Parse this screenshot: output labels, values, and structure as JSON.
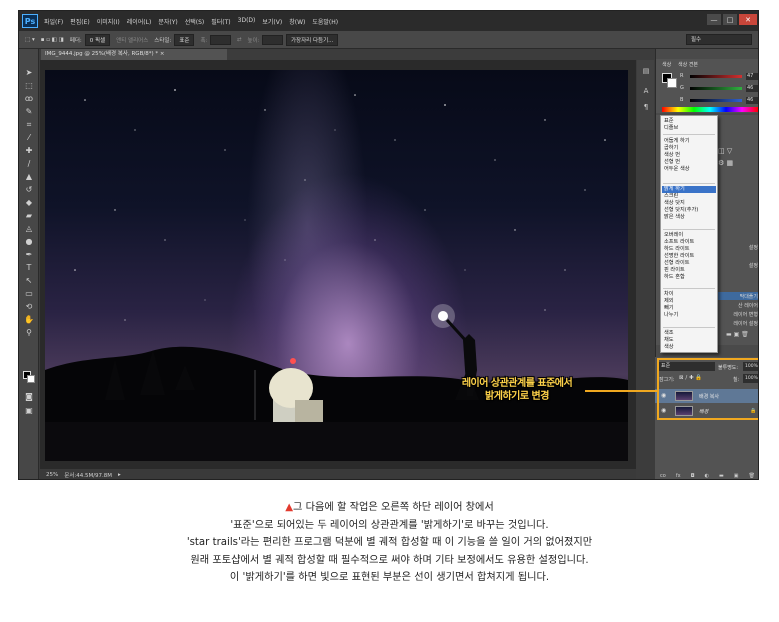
{
  "app": {
    "logo": "Ps",
    "menus": [
      "파일(F)",
      "편집(E)",
      "이미지(I)",
      "레이어(L)",
      "문자(Y)",
      "선택(S)",
      "필터(T)",
      "3D(D)",
      "보기(V)",
      "창(W)",
      "도움말(H)"
    ],
    "window_controls": [
      "—",
      "□",
      "✕"
    ]
  },
  "options_bar": {
    "feather_label": "페더:",
    "feather_value": "0 픽셀",
    "antialias": "앤티 앨리어스",
    "style_label": "스타일:",
    "style_value": "표준",
    "width_label": "폭:",
    "height_label": "높이:",
    "refine_edge": "가장자리 다듬기...",
    "workspace": "필수"
  },
  "document": {
    "tab": "IMG_9444.jpg @ 25%(배경 복사, RGB/8*) * ×"
  },
  "status_bar": {
    "zoom": "25%",
    "doc_info": "문서:44.5M/97.8M"
  },
  "color_panel": {
    "tabs": [
      "색상",
      "색상 견본"
    ],
    "channels": [
      {
        "label": "R",
        "value": "47",
        "color": "#d23030"
      },
      {
        "label": "G",
        "value": "46",
        "color": "#30b040"
      },
      {
        "label": "B",
        "value": "46",
        "color": "#3060d0"
      }
    ]
  },
  "mid_panel": {
    "visible_items": [
      "설정",
      "설정",
      "막대플기",
      "산 레이어",
      "레이어 변형",
      "레이어 설정"
    ]
  },
  "blend_menu": {
    "groups": [
      [
        "표준",
        "디졸브"
      ],
      [
        "어둡게 하기",
        "곱하기",
        "색상 번",
        "선형 번",
        "어두운 색상"
      ],
      [
        "밝게 하기",
        "스크린",
        "색상 닷지",
        "선형 닷지(추가)",
        "밝은 색상"
      ],
      [
        "오버레이",
        "소프트 라이트",
        "하드 라이트",
        "선명한 라이트",
        "선형 라이트",
        "핀 라이트",
        "하드 혼합"
      ],
      [
        "차이",
        "제외",
        "빼기",
        "나누기"
      ],
      [
        "색조",
        "채도",
        "색상",
        "광도"
      ]
    ],
    "selected": "밝게 하기"
  },
  "layers_panel": {
    "blend_mode": "표준",
    "opacity_label": "불투명도:",
    "opacity_value": "100%",
    "lock_label": "잠그기:",
    "fill_label": "칠:",
    "fill_value": "100%",
    "layers": [
      {
        "name": "배경 복사",
        "selected": true
      },
      {
        "name": "배경",
        "selected": false
      }
    ],
    "footer_icons": [
      "co",
      "fx",
      "◘",
      "◐",
      "▬",
      "▣",
      "🗑"
    ]
  },
  "callout": {
    "line1": "레이어 상관관계를 표준에서",
    "line2": "밝게하기로 변경",
    "color": "#ffd34a"
  },
  "caption": {
    "marker": "▲",
    "lines": [
      "그 다음에 할 작업은 오른쪽 하단 레이어 창에서",
      "'표준'으로 되어있는 두 레이어의 상관관계를 '밝게하기'로 바꾸는 것입니다.",
      "'star trails'라는 편리한 프로그램 덕분에 별 궤적 합성할 때 이 기능을 쓸 일이 거의 없어졌지만",
      "원래 포토샵에서 별 궤적 합성할 때 필수적으로 써야 하며 기타 보정에서도 유용한 설정입니다.",
      "이 '밝게하기'를 하면 빛으로 표현된 부분은 선이 생기면서 합쳐지게 됩니다."
    ]
  }
}
